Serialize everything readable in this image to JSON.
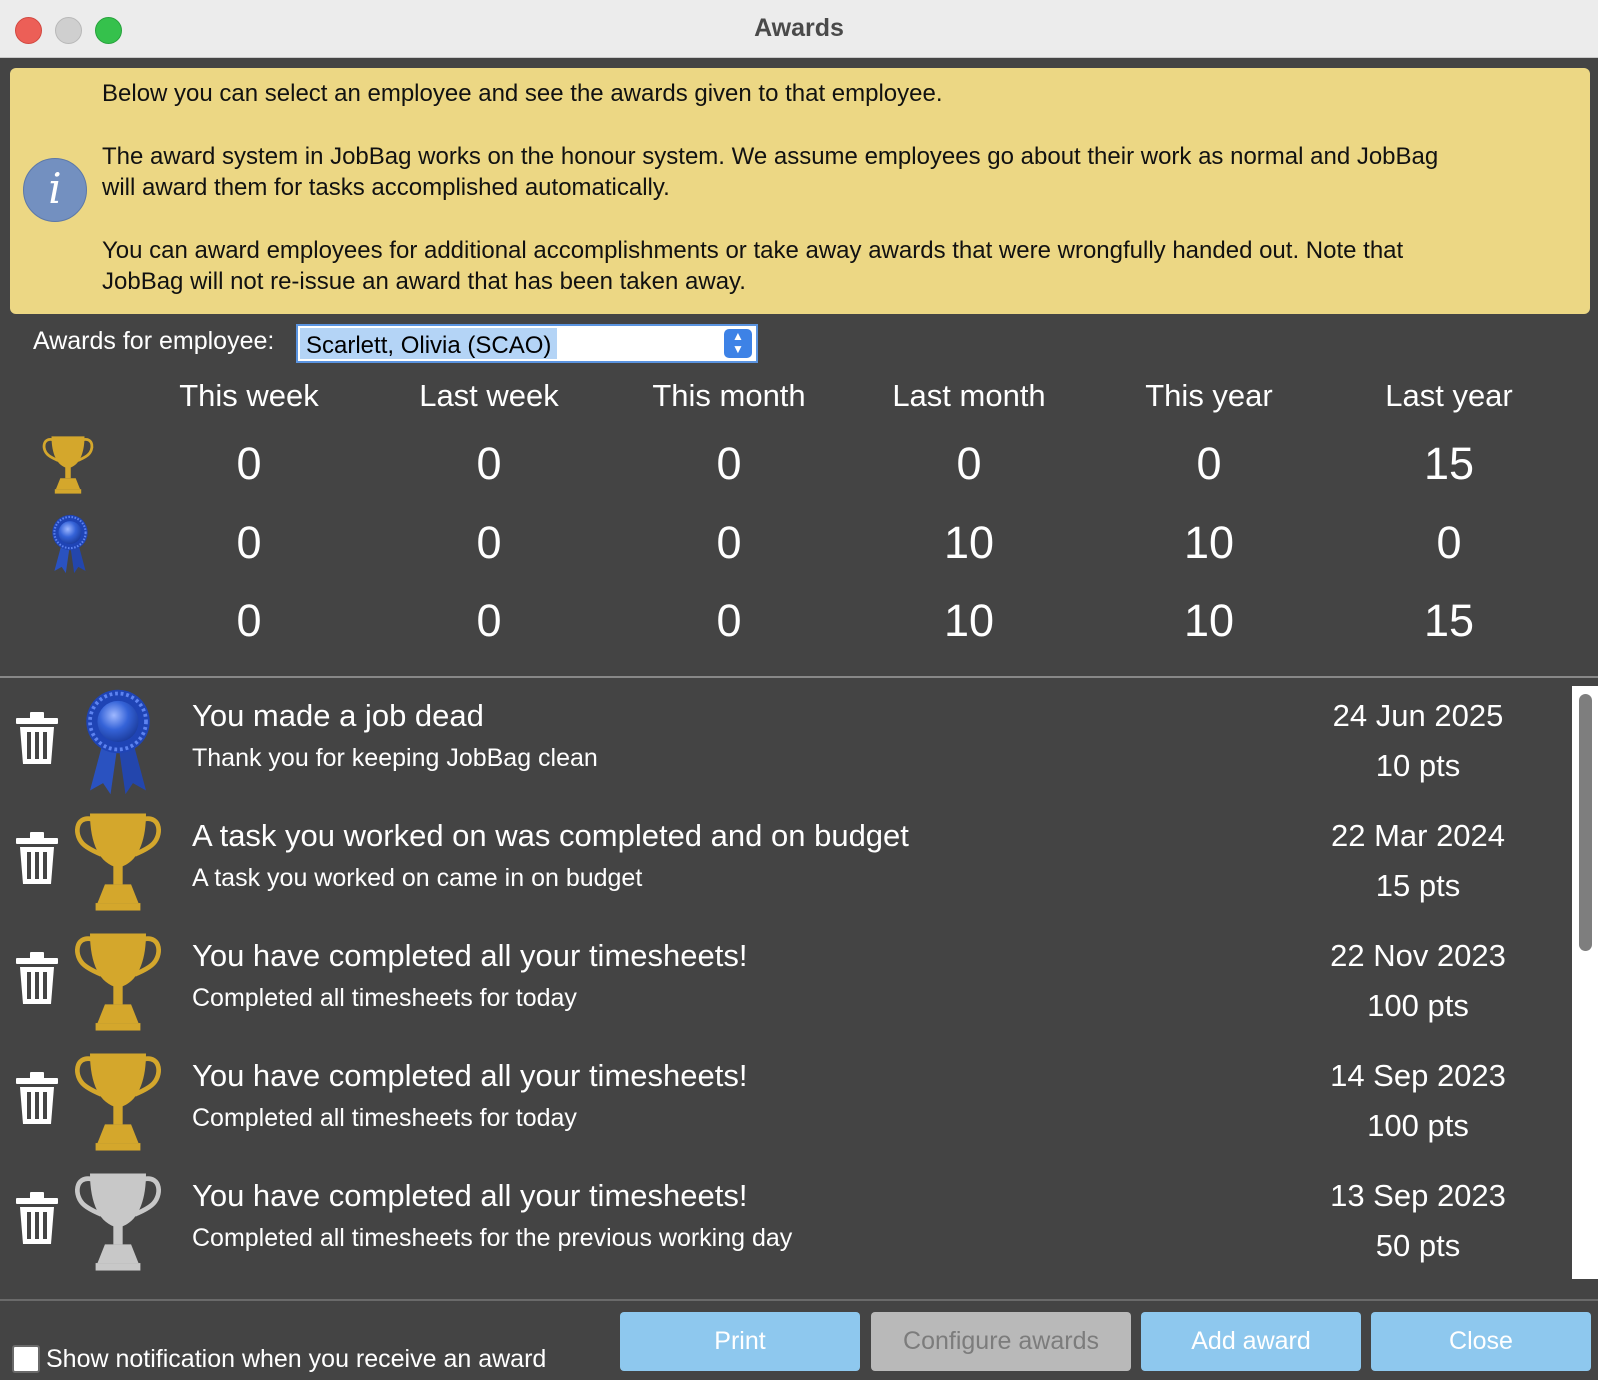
{
  "window": {
    "title": "Awards"
  },
  "info": {
    "icon": "info-icon",
    "paragraph1": "Below you can select an employee and see the awards given to that employee.",
    "paragraph2_line1": "The award system in JobBag works on the honour system. We assume employees go about their work as normal and JobBag",
    "paragraph2_line2": "will award them for tasks accomplished automatically.",
    "paragraph3_line1": "You can award employees for additional accomplishments or take away awards that were wrongfully handed out. Note that",
    "paragraph3_line2": "JobBag will not re-issue an award that has been taken away."
  },
  "employee": {
    "label": "Awards for employee:",
    "selected": "Scarlett, Olivia (SCAO)"
  },
  "summary": {
    "columns": [
      "This week",
      "Last week",
      "This month",
      "Last month",
      "This year",
      "Last year"
    ],
    "rows": [
      {
        "icon": "trophy-icon",
        "values": [
          "0",
          "0",
          "0",
          "0",
          "0",
          "15"
        ]
      },
      {
        "icon": "ribbon-icon",
        "values": [
          "0",
          "0",
          "0",
          "10",
          "10",
          "0"
        ]
      },
      {
        "icon": "",
        "values": [
          "0",
          "0",
          "0",
          "10",
          "10",
          "15"
        ]
      }
    ]
  },
  "awards": [
    {
      "icon": "blue-ribbon-icon",
      "title": "You made a job dead",
      "subtitle": "Thank you for keeping JobBag clean",
      "date": "24 Jun 2025",
      "points": "10 pts"
    },
    {
      "icon": "gold-trophy-icon",
      "title": "A task you worked on was completed and on budget",
      "subtitle": "A task you worked on came in on budget",
      "date": "22 Mar 2024",
      "points": "15 pts"
    },
    {
      "icon": "gold-trophy-icon",
      "title": "You have completed all your timesheets!",
      "subtitle": "Completed all timesheets for today",
      "date": "22 Nov 2023",
      "points": "100 pts"
    },
    {
      "icon": "gold-trophy-icon",
      "title": "You have completed all your timesheets!",
      "subtitle": "Completed all timesheets for today",
      "date": "14 Sep 2023",
      "points": "100 pts"
    },
    {
      "icon": "silver-trophy-icon",
      "title": "You have completed all your timesheets!",
      "subtitle": "Completed all timesheets for the previous working day",
      "date": "13 Sep 2023",
      "points": "50 pts"
    }
  ],
  "footer": {
    "notification_label": "Show notification when you receive an award",
    "notification_checked": false,
    "buttons": {
      "print": "Print",
      "configure": "Configure awards",
      "add": "Add award",
      "close": "Close"
    }
  },
  "colors": {
    "background": "#444444",
    "info_banner": "#ecd784",
    "button": "#8ec8ee",
    "button_disabled": "#b9b9b9",
    "gold": "#d4a72c",
    "ribbon_blue": "#2f5fd0",
    "silver": "#c8c8c8"
  }
}
